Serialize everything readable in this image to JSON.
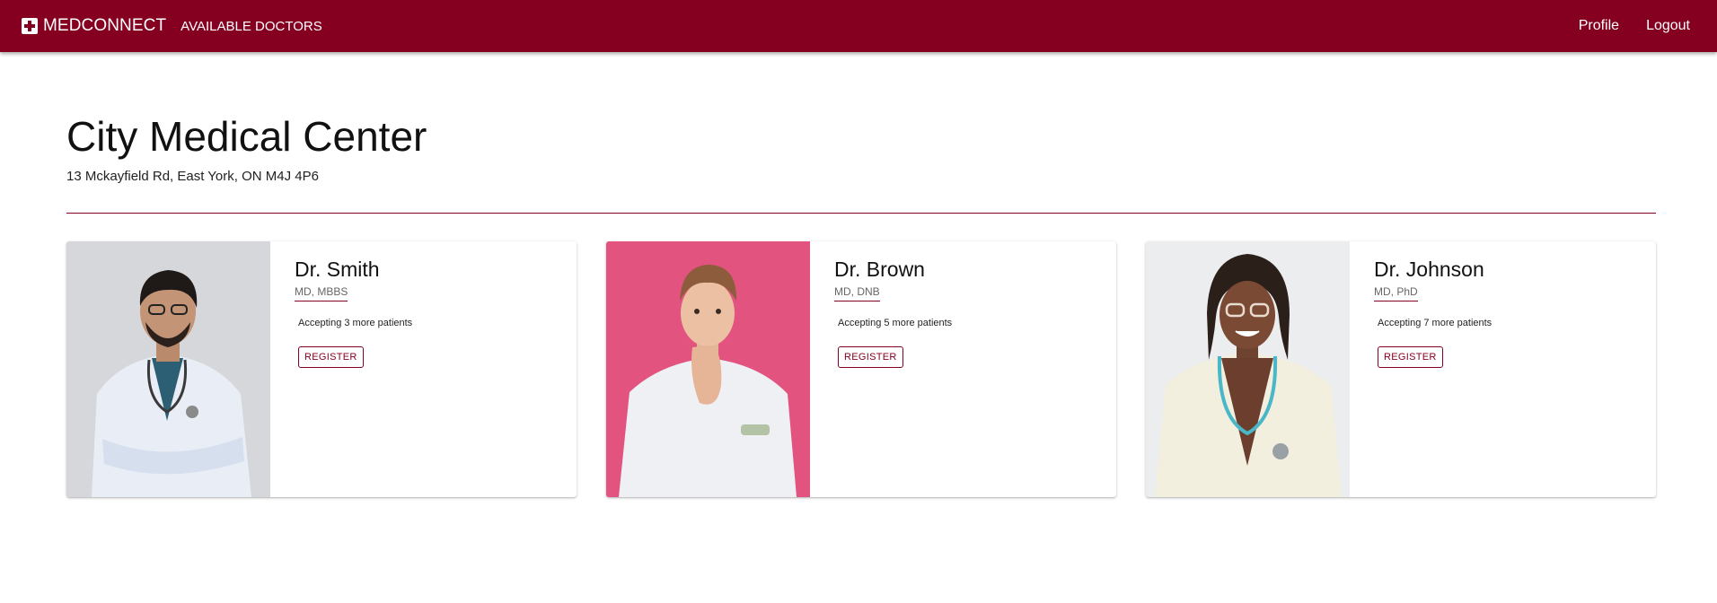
{
  "app": {
    "brand": "MEDCONNECT",
    "brand_icon": "medical-cross-icon",
    "accent": "#850020"
  },
  "nav": {
    "available_doctors": "AVAILABLE DOCTORS",
    "profile": "Profile",
    "logout": "Logout"
  },
  "clinic": {
    "name": "City Medical Center",
    "address": "13 Mckayfield Rd, East York, ON M4J 4P6"
  },
  "doctors": [
    {
      "name": "Dr. Smith",
      "credentials": "MD, MBBS",
      "availability": "Accepting 3 more patients",
      "action": "REGISTER"
    },
    {
      "name": "Dr. Brown",
      "credentials": "MD, DNB",
      "availability": "Accepting 5 more patients",
      "action": "REGISTER"
    },
    {
      "name": "Dr. Johnson",
      "credentials": "MD, PhD",
      "availability": "Accepting 7 more patients",
      "action": "REGISTER"
    }
  ]
}
